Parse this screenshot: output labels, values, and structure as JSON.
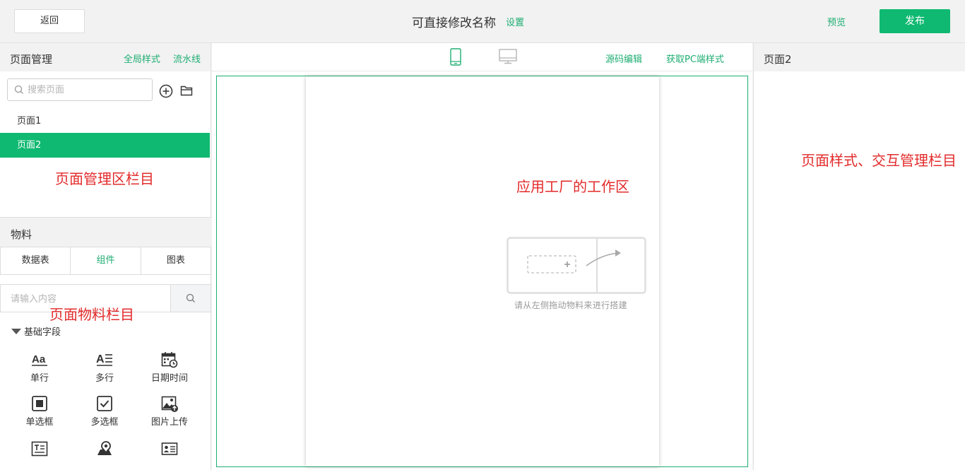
{
  "header": {
    "back_label": "返回",
    "app_title": "可直接修改名称",
    "settings_label": "设置",
    "preview_label": "预览",
    "publish_label": "发布"
  },
  "page_manager": {
    "title": "页面管理",
    "global_style_label": "全局样式",
    "pipeline_label": "流水线",
    "search_placeholder": "搜索页面",
    "pages": [
      {
        "label": "页面1",
        "active": false
      },
      {
        "label": "页面2",
        "active": true
      }
    ],
    "annotation": "页面管理区栏目"
  },
  "materials": {
    "title": "物料",
    "tabs": [
      {
        "label": "数据表",
        "active": false
      },
      {
        "label": "组件",
        "active": true
      },
      {
        "label": "图表",
        "active": false
      }
    ],
    "search_placeholder": "请输入内容",
    "annotation": "页面物料栏目",
    "group_title": "基础字段",
    "fields": [
      {
        "label": "单行",
        "icon": "single-line-text-icon"
      },
      {
        "label": "多行",
        "icon": "multi-line-text-icon"
      },
      {
        "label": "日期时间",
        "icon": "calendar-clock-icon"
      },
      {
        "label": "单选框",
        "icon": "radio-box-icon"
      },
      {
        "label": "多选框",
        "icon": "checkbox-icon"
      },
      {
        "label": "图片上传",
        "icon": "image-upload-icon"
      },
      {
        "label": "",
        "icon": "text-card-icon"
      },
      {
        "label": "",
        "icon": "location-icon"
      },
      {
        "label": "",
        "icon": "id-card-icon"
      }
    ]
  },
  "canvas": {
    "source_edit_label": "源码编辑",
    "get_pc_style_label": "获取PC端样式",
    "annotation": "应用工厂的工作区",
    "empty_hint": "请从左侧拖动物料来进行搭建",
    "view_modes": [
      "mobile-icon",
      "desktop-icon"
    ],
    "active_view": "mobile"
  },
  "properties": {
    "title": "页面2",
    "annotation": "页面样式、交互管理栏目"
  },
  "colors": {
    "accent": "#1fae73",
    "primary_button": "#0fb971",
    "annotation_red": "#e32b2b"
  }
}
